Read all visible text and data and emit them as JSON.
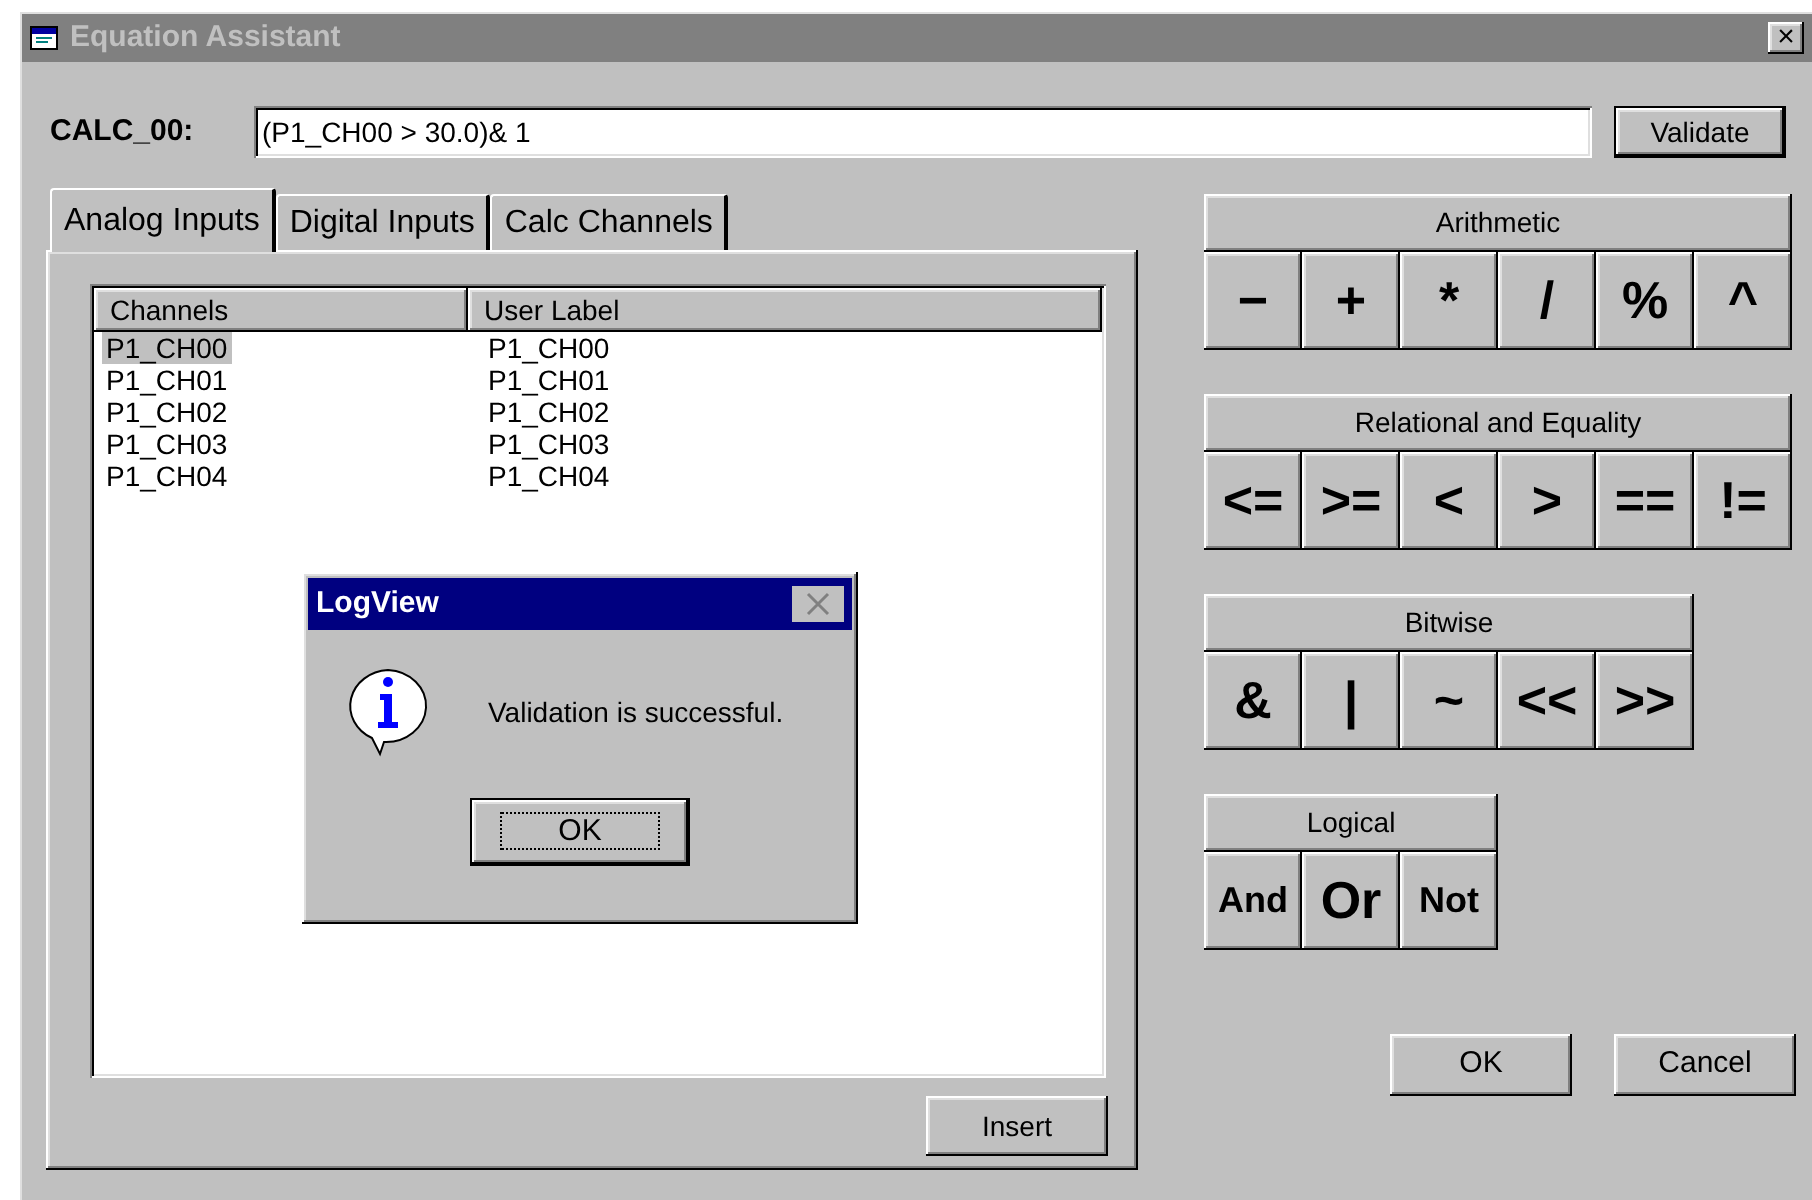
{
  "window": {
    "title": "Equation Assistant",
    "close": "×"
  },
  "expression": {
    "label": "CALC_00:",
    "value": "(P1_CH00 > 30.0)& 1"
  },
  "validate_button": "Validate",
  "tabs": [
    {
      "label": "Analog Inputs",
      "selected": true
    },
    {
      "label": "Digital Inputs",
      "selected": false
    },
    {
      "label": "Calc Channels",
      "selected": false
    }
  ],
  "table": {
    "columns": [
      "Channels",
      "User Label"
    ],
    "rows": [
      {
        "cells": [
          "P1_CH00",
          "P1_CH00"
        ],
        "selected": true
      },
      {
        "cells": [
          "P1_CH01",
          "P1_CH01"
        ],
        "selected": false
      },
      {
        "cells": [
          "P1_CH02",
          "P1_CH02"
        ],
        "selected": false
      },
      {
        "cells": [
          "P1_CH03",
          "P1_CH03"
        ],
        "selected": false
      },
      {
        "cells": [
          "P1_CH04",
          "P1_CH04"
        ],
        "selected": false
      }
    ]
  },
  "insert_button": "Insert",
  "operator_groups": [
    {
      "title": "Arithmetic",
      "buttons": [
        "−",
        "+",
        "*",
        "/",
        "%",
        "^"
      ]
    },
    {
      "title": "Relational and Equality",
      "buttons": [
        "<=",
        ">=",
        "<",
        ">",
        "==",
        "!="
      ]
    },
    {
      "title": "Bitwise",
      "buttons": [
        "&",
        "|",
        "~",
        "<<",
        ">>"
      ]
    },
    {
      "title": "Logical",
      "buttons": [
        "And",
        "Or",
        "Not"
      ]
    }
  ],
  "buttons": [
    "OK",
    "Cancel"
  ],
  "message_box": {
    "title": "LogView",
    "message": "Validation is successful.",
    "button": "OK"
  }
}
